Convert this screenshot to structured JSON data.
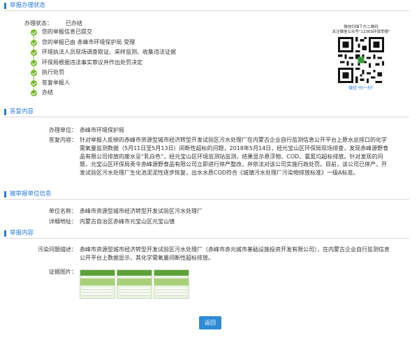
{
  "status_section": {
    "title": "举报办理状态",
    "status_label": "办理状态：",
    "status_value": "已办结",
    "steps": [
      "您的举报信息已提交",
      "您的举报已由 赤峰市环境保护局 受理",
      "环境执法人员现场调查取证、采样监测、收集违法证据",
      "环保局根据违法事实审议并作出处罚决定",
      "执行处罚",
      "答复举报人",
      "办结"
    ],
    "qr_tip_line1": "微信扫描下方二维码",
    "qr_tip_line2": "关注微信公众号\"12369环保举报\"",
    "qr_scan_label": "微信\"扫一扫\""
  },
  "reply_section": {
    "title": "答复内容",
    "unit_label": "办理单位：",
    "unit_value": "赤峰市环境保护局",
    "content_label": "答复内容：",
    "content_value": "针对举报人反映的赤峰市资源型城市经济转型开发试验区污水处理厂在内蒙古企业自行监测信息公开平台上原水总排口的化学需氧量监测数据（5月11日至5月13日）间断性超标的问题，2018年5月14日，经元宝山区环保局现场排查，发现赤峰源野食品有限公司排放的废水呈“乳白色”，经元宝山区环境监测站监测，结果显示悬浮物、COD、氨氮均超标排放。针对发现的问题，元宝山区环保局责令赤峰源野食品有限公司立即进行停产整改，并依法对该公司实施行政处罚。目前，该公司已停产，开发试验区污水处理厂生化池泥泥性逐步恢复，出水水质COD符合《城镇污水处理厂污染物排放标准》一级A标准。"
  },
  "reported_section": {
    "title": "被举报单位信息",
    "name_label": "单位名称：",
    "name_value": "赤峰市资源型城市经济转型开发试验区污水处理厂",
    "address_label": "详细地址：",
    "address_value": "内蒙古自治区赤峰市元宝山区元宝山镇"
  },
  "report_section": {
    "title": "举报内容",
    "desc_label": "污染问题描述：",
    "desc_value": "赤峰市资源型城市经济转型开发试验区污水处理厂（赤峰市赤元城市基础设施投资开发有限公司），在内蒙古企业自行监测信息公开平台上数据显示，其化学需氧量间断性超标排放。",
    "images_label": "证据图片："
  },
  "back_button_label": "返回",
  "colors": {
    "accent": "#2b7bd6",
    "check": "#7ab829",
    "button": "#2d8bd8"
  }
}
